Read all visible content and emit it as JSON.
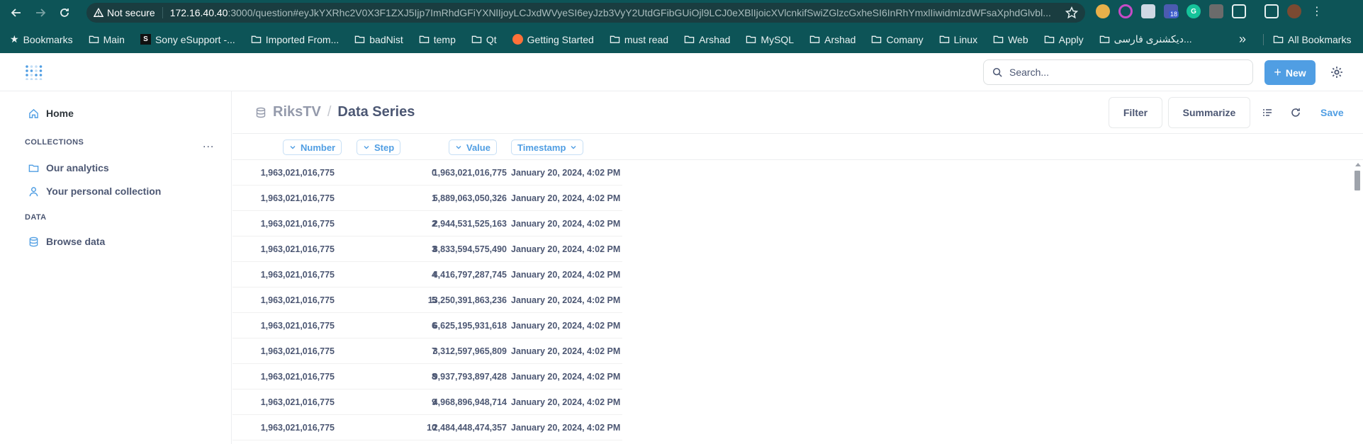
{
  "browser": {
    "security_label": "Not secure",
    "url_host": "172.16.40.40",
    "url_rest": ":3000/question#eyJkYXRhc2V0X3F1ZXJ5Ijp7ImRhdGFiYXNlIjoyLCJxdWVyeSI6eyJzb3VyY2UtdGFibGUiOjl9LCJ0eXBlIjoicXVlcnkifSwiZGlzcGxheSI6InRhYmxlIiwidmlzdWFsaXphdGlvbl...",
    "extension_badge": "18",
    "bookmarks": [
      {
        "label": "Bookmarks",
        "icon": "star-icon"
      },
      {
        "label": "Main",
        "icon": "folder-icon"
      },
      {
        "label": "Sony eSupport -...",
        "icon": "sony-logo-icon"
      },
      {
        "label": "Imported From...",
        "icon": "folder-icon"
      },
      {
        "label": "badNist",
        "icon": "folder-icon"
      },
      {
        "label": "temp",
        "icon": "folder-icon"
      },
      {
        "label": "Qt",
        "icon": "folder-icon"
      },
      {
        "label": "Getting Started",
        "icon": "firefox-icon"
      },
      {
        "label": "must read",
        "icon": "folder-icon"
      },
      {
        "label": "Arshad",
        "icon": "folder-icon"
      },
      {
        "label": "MySQL",
        "icon": "folder-icon"
      },
      {
        "label": "Arshad",
        "icon": "folder-icon"
      },
      {
        "label": "Comany",
        "icon": "folder-icon"
      },
      {
        "label": "Linux",
        "icon": "folder-icon"
      },
      {
        "label": "Web",
        "icon": "folder-icon"
      },
      {
        "label": "Apply",
        "icon": "folder-icon"
      },
      {
        "label": "دیکشنری فارسی...",
        "icon": "folder-icon"
      }
    ],
    "more_label": "»",
    "all_bookmarks_label": "All Bookmarks"
  },
  "header": {
    "search_placeholder": "Search...",
    "new_label": "New"
  },
  "sidebar": {
    "home_label": "Home",
    "collections_heading": "COLLECTIONS",
    "collections_menu": "...",
    "collections": [
      "Our analytics",
      "Your personal collection"
    ],
    "data_heading": "DATA",
    "browse_label": "Browse data"
  },
  "question": {
    "database": "RiksTV",
    "separator": "/",
    "title": "Data Series",
    "filter_label": "Filter",
    "summarize_label": "Summarize",
    "save_label": "Save"
  },
  "table": {
    "columns": [
      "Number",
      "Step",
      "Value",
      "Timestamp"
    ],
    "rows": [
      [
        "1,963,021,016,775",
        "0",
        "1,963,021,016,775",
        "January 20, 2024, 4:02 PM"
      ],
      [
        "1,963,021,016,775",
        "1",
        "5,889,063,050,326",
        "January 20, 2024, 4:02 PM"
      ],
      [
        "1,963,021,016,775",
        "2",
        "2,944,531,525,163",
        "January 20, 2024, 4:02 PM"
      ],
      [
        "1,963,021,016,775",
        "3",
        "8,833,594,575,490",
        "January 20, 2024, 4:02 PM"
      ],
      [
        "1,963,021,016,775",
        "4",
        "4,416,797,287,745",
        "January 20, 2024, 4:02 PM"
      ],
      [
        "1,963,021,016,775",
        "5",
        "13,250,391,863,236",
        "January 20, 2024, 4:02 PM"
      ],
      [
        "1,963,021,016,775",
        "6",
        "6,625,195,931,618",
        "January 20, 2024, 4:02 PM"
      ],
      [
        "1,963,021,016,775",
        "7",
        "3,312,597,965,809",
        "January 20, 2024, 4:02 PM"
      ],
      [
        "1,963,021,016,775",
        "8",
        "9,937,793,897,428",
        "January 20, 2024, 4:02 PM"
      ],
      [
        "1,963,021,016,775",
        "9",
        "4,968,896,948,714",
        "January 20, 2024, 4:02 PM"
      ],
      [
        "1,963,021,016,775",
        "10",
        "2,484,448,474,357",
        "January 20, 2024, 4:02 PM"
      ]
    ]
  },
  "colors": {
    "browser_chrome": "#0d5457",
    "brand_blue": "#509ee3",
    "text_dark": "#4c5773",
    "text_muted": "#949aab"
  }
}
